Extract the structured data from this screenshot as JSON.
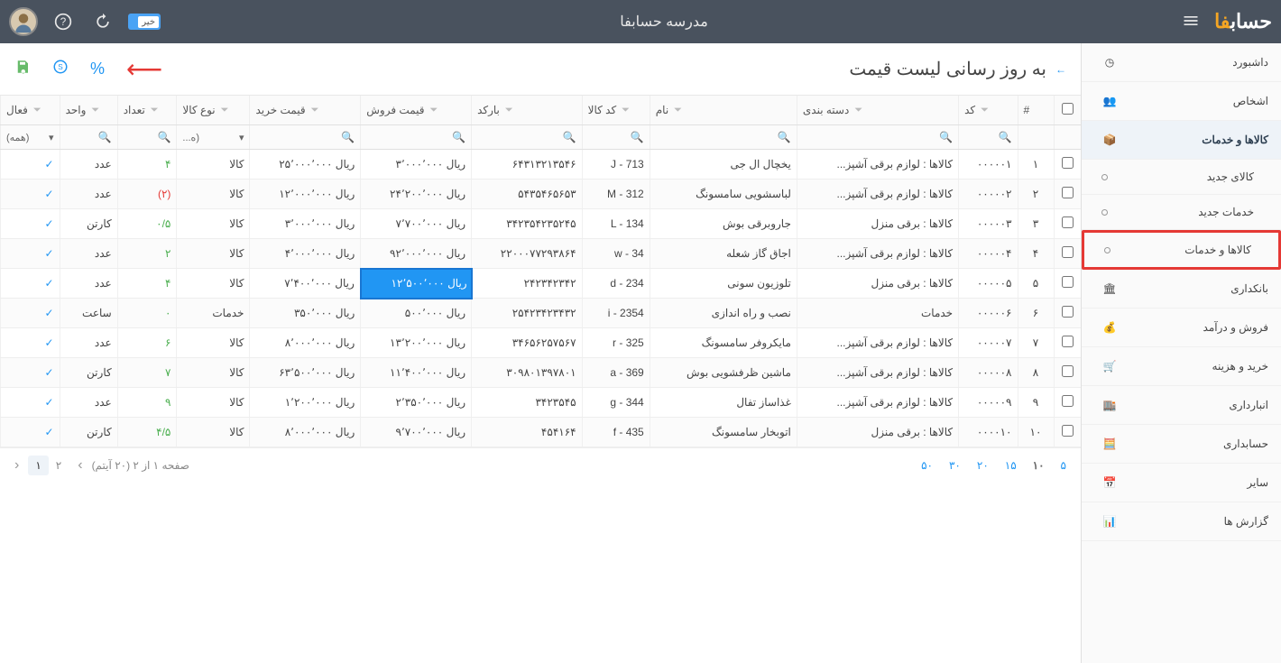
{
  "header": {
    "logo_brand_ar": "حساب",
    "logo_brand_fa": "فا",
    "title": "مدرسه حسابفا",
    "toggle_label": "خیر"
  },
  "sidebar": {
    "items": [
      {
        "label": "داشبورد",
        "icon": "dashboard"
      },
      {
        "label": "اشخاص",
        "icon": "people"
      },
      {
        "label": "کالاها و خدمات",
        "icon": "box",
        "active": true
      },
      {
        "label": "کالای جدید",
        "sub": true
      },
      {
        "label": "خدمات جدید",
        "sub": true
      },
      {
        "label": "کالاها و خدمات",
        "sub": true,
        "highlighted": true
      },
      {
        "label": "بانکداری",
        "icon": "bank"
      },
      {
        "label": "فروش و درآمد",
        "icon": "income"
      },
      {
        "label": "خرید و هزینه",
        "icon": "cart"
      },
      {
        "label": "انبارداری",
        "icon": "warehouse"
      },
      {
        "label": "حسابداری",
        "icon": "calc"
      },
      {
        "label": "سایر",
        "icon": "other"
      },
      {
        "label": "گزارش ها",
        "icon": "report"
      }
    ]
  },
  "page": {
    "title": "به روز رسانی لیست قیمت"
  },
  "table": {
    "columns": [
      "#",
      "کد",
      "دسته بندی",
      "نام",
      "کد کالا",
      "بارکد",
      "قیمت فروش",
      "قیمت خرید",
      "نوع کالا",
      "تعداد",
      "واحد",
      "فعال"
    ],
    "filter_all": "(همه)",
    "filter_type": "(ه...",
    "rows": [
      {
        "n": "۱",
        "code": "۰۰۰۰۰۱",
        "cat": "کالاها : لوازم برقی آشپز...",
        "name": "یخچال ال جی",
        "pcode": "J - 713",
        "barcode": "۶۴۳۱۳۲۱۳۵۴۶",
        "sell": "ریال ۳٬۰۰۰٬۰۰۰",
        "buy": "ریال ۲۵٬۰۰۰٬۰۰۰",
        "type": "کالا",
        "qty": "۴",
        "qty_cls": "pos",
        "unit": "عدد"
      },
      {
        "n": "۲",
        "code": "۰۰۰۰۰۲",
        "cat": "کالاها : لوازم برقی آشپز...",
        "name": "لباسشویی سامسونگ",
        "pcode": "M - 312",
        "barcode": "۵۴۳۵۴۶۵۶۵۳",
        "sell": "ریال ۲۴٬۲۰۰٬۰۰۰",
        "buy": "ریال ۱۲٬۰۰۰٬۰۰۰",
        "type": "کالا",
        "qty": "(۲)",
        "qty_cls": "neg",
        "unit": "عدد"
      },
      {
        "n": "۳",
        "code": "۰۰۰۰۰۳",
        "cat": "کالاها : برقی منزل",
        "name": "جاروبرقی بوش",
        "pcode": "L - 134",
        "barcode": "۳۴۲۳۵۴۲۳۵۲۴۵",
        "sell": "ریال ۷٬۷۰۰٬۰۰۰",
        "buy": "ریال ۳٬۰۰۰٬۰۰۰",
        "type": "کالا",
        "qty": "۰/۵",
        "qty_cls": "pos",
        "unit": "کارتن"
      },
      {
        "n": "۴",
        "code": "۰۰۰۰۰۴",
        "cat": "کالاها : لوازم برقی آشپز...",
        "name": "اجاق گاز شعله",
        "pcode": "w - 34",
        "barcode": "۲۲۰۰۰۷۷۲۹۳۸۶۴",
        "sell": "ریال ۹۲٬۰۰۰٬۰۰۰",
        "buy": "ریال ۴٬۰۰۰٬۰۰۰",
        "type": "کالا",
        "qty": "۲",
        "qty_cls": "pos",
        "unit": "عدد"
      },
      {
        "n": "۵",
        "code": "۰۰۰۰۰۵",
        "cat": "کالاها : برقی منزل",
        "name": "تلوزیون سونی",
        "pcode": "d - 234",
        "barcode": "۲۴۲۳۴۲۳۴۲",
        "sell": "ریال ۱۲٬۵۰۰٬۰۰۰",
        "sell_editing": true,
        "buy": "ریال ۷٬۴۰۰٬۰۰۰",
        "type": "کالا",
        "qty": "۴",
        "qty_cls": "pos",
        "unit": "عدد"
      },
      {
        "n": "۶",
        "code": "۰۰۰۰۰۶",
        "cat": "خدمات",
        "name": "نصب و راه اندازی",
        "pcode": "i - 2354",
        "barcode": "۲۵۴۲۳۴۲۳۴۳۲",
        "sell": "ریال ۵۰۰٬۰۰۰",
        "buy": "ریال ۳۵۰٬۰۰۰",
        "type": "خدمات",
        "qty": "۰",
        "qty_cls": "pos",
        "unit": "ساعت"
      },
      {
        "n": "۷",
        "code": "۰۰۰۰۰۷",
        "cat": "کالاها : لوازم برقی آشپز...",
        "name": "مایکروفر سامسونگ",
        "pcode": "r - 325",
        "barcode": "۳۴۶۵۶۲۵۷۵۶۷",
        "sell": "ریال ۱۳٬۲۰۰٬۰۰۰",
        "buy": "ریال ۸٬۰۰۰٬۰۰۰",
        "type": "کالا",
        "qty": "۶",
        "qty_cls": "pos",
        "unit": "عدد"
      },
      {
        "n": "۸",
        "code": "۰۰۰۰۰۸",
        "cat": "کالاها : لوازم برقی آشپز...",
        "name": "ماشین ظرفشویی بوش",
        "pcode": "a - 369",
        "barcode": "۳۰۹۸۰۱۳۹۷۸۰۱",
        "sell": "ریال ۱۱٬۴۰۰٬۰۰۰",
        "buy": "ریال ۶۳٬۵۰۰٬۰۰۰",
        "type": "کالا",
        "qty": "۷",
        "qty_cls": "pos",
        "unit": "کارتن"
      },
      {
        "n": "۹",
        "code": "۰۰۰۰۰۹",
        "cat": "کالاها : لوازم برقی آشپز...",
        "name": "غذاساز تفال",
        "pcode": "g - 344",
        "barcode": "۳۴۲۳۵۴۵",
        "sell": "ریال ۲٬۳۵۰٬۰۰۰",
        "buy": "ریال ۱٬۲۰۰٬۰۰۰",
        "type": "کالا",
        "qty": "۹",
        "qty_cls": "pos",
        "unit": "عدد"
      },
      {
        "n": "۱۰",
        "code": "۰۰۰۰۱۰",
        "cat": "کالاها : برقی منزل",
        "name": "اتوبخار سامسونگ",
        "pcode": "f - 435",
        "barcode": "۴۵۴۱۶۴",
        "sell": "ریال ۹٬۷۰۰٬۰۰۰",
        "buy": "ریال ۸٬۰۰۰٬۰۰۰",
        "type": "کالا",
        "qty": "۴/۵",
        "qty_cls": "pos",
        "unit": "کارتن"
      }
    ]
  },
  "pagination": {
    "sizes": [
      "۵",
      "۱۰",
      "۱۵",
      "۲۰",
      "۳۰",
      "۵۰"
    ],
    "active_size": "۱۰",
    "info": "صفحه ۱ از ۲ (۲۰ آیتم)",
    "pages": [
      "۱",
      "۲"
    ],
    "active_page": "۱"
  }
}
